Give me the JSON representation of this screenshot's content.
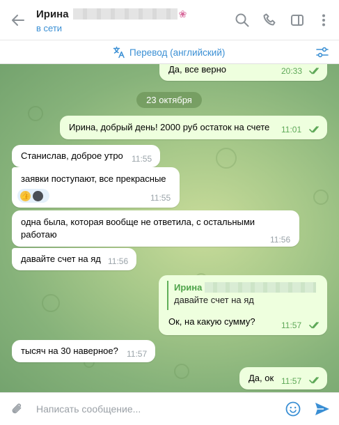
{
  "header": {
    "contact_name": "Ирина",
    "status": "в сети",
    "icons": [
      "back-arrow-icon",
      "search-icon",
      "phone-icon",
      "sidebar-icon",
      "more-icon"
    ]
  },
  "translate_bar": {
    "label": "Перевод (английский)",
    "icons": [
      "translate-icon",
      "settings-sliders-icon"
    ]
  },
  "chat": {
    "date_separator": "23 октября",
    "messages": [
      {
        "direction": "out",
        "text": "Да, все верно",
        "time": "20:33",
        "read": true
      },
      {
        "direction": "out",
        "text": "Ирина, добрый день! 2000 руб остаток на счете",
        "time": "11:01",
        "read": true
      },
      {
        "direction": "in",
        "text": "Станислав, доброе утро",
        "time": "11:55"
      },
      {
        "direction": "in",
        "text": "заявки поступают, все прекрасные",
        "time": "11:55",
        "reaction": "👍"
      },
      {
        "direction": "in",
        "text": "одна была, которая вообще не ответила, с остальными работаю",
        "time": "11:56"
      },
      {
        "direction": "in",
        "text": "давайте счет на яд",
        "time": "11:56"
      },
      {
        "direction": "out",
        "reply_to": {
          "name": "Ирина",
          "text": "давайте счет на яд"
        },
        "text": "Ок, на какую сумму?",
        "time": "11:57",
        "read": true
      },
      {
        "direction": "in",
        "text": "тысяч на 30 наверное?",
        "time": "11:57"
      },
      {
        "direction": "out",
        "text": "Да, ок",
        "time": "11:57",
        "read": true
      }
    ]
  },
  "composer": {
    "placeholder": "Написать сообщение...",
    "icons": [
      "paperclip-icon",
      "emoji-icon",
      "send-icon"
    ]
  },
  "colors": {
    "accent": "#3a8fd4",
    "outgoing_bubble": "#eeffde",
    "incoming_bubble": "#ffffff",
    "read_tick": "#5ea858"
  }
}
